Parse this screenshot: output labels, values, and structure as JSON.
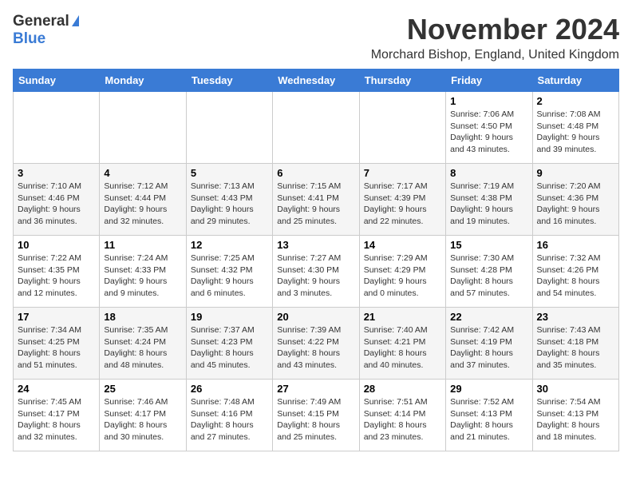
{
  "logo": {
    "general": "General",
    "blue": "Blue"
  },
  "title": "November 2024",
  "location": "Morchard Bishop, England, United Kingdom",
  "days_of_week": [
    "Sunday",
    "Monday",
    "Tuesday",
    "Wednesday",
    "Thursday",
    "Friday",
    "Saturday"
  ],
  "weeks": [
    [
      {
        "day": "",
        "info": ""
      },
      {
        "day": "",
        "info": ""
      },
      {
        "day": "",
        "info": ""
      },
      {
        "day": "",
        "info": ""
      },
      {
        "day": "",
        "info": ""
      },
      {
        "day": "1",
        "info": "Sunrise: 7:06 AM\nSunset: 4:50 PM\nDaylight: 9 hours and 43 minutes."
      },
      {
        "day": "2",
        "info": "Sunrise: 7:08 AM\nSunset: 4:48 PM\nDaylight: 9 hours and 39 minutes."
      }
    ],
    [
      {
        "day": "3",
        "info": "Sunrise: 7:10 AM\nSunset: 4:46 PM\nDaylight: 9 hours and 36 minutes."
      },
      {
        "day": "4",
        "info": "Sunrise: 7:12 AM\nSunset: 4:44 PM\nDaylight: 9 hours and 32 minutes."
      },
      {
        "day": "5",
        "info": "Sunrise: 7:13 AM\nSunset: 4:43 PM\nDaylight: 9 hours and 29 minutes."
      },
      {
        "day": "6",
        "info": "Sunrise: 7:15 AM\nSunset: 4:41 PM\nDaylight: 9 hours and 25 minutes."
      },
      {
        "day": "7",
        "info": "Sunrise: 7:17 AM\nSunset: 4:39 PM\nDaylight: 9 hours and 22 minutes."
      },
      {
        "day": "8",
        "info": "Sunrise: 7:19 AM\nSunset: 4:38 PM\nDaylight: 9 hours and 19 minutes."
      },
      {
        "day": "9",
        "info": "Sunrise: 7:20 AM\nSunset: 4:36 PM\nDaylight: 9 hours and 16 minutes."
      }
    ],
    [
      {
        "day": "10",
        "info": "Sunrise: 7:22 AM\nSunset: 4:35 PM\nDaylight: 9 hours and 12 minutes."
      },
      {
        "day": "11",
        "info": "Sunrise: 7:24 AM\nSunset: 4:33 PM\nDaylight: 9 hours and 9 minutes."
      },
      {
        "day": "12",
        "info": "Sunrise: 7:25 AM\nSunset: 4:32 PM\nDaylight: 9 hours and 6 minutes."
      },
      {
        "day": "13",
        "info": "Sunrise: 7:27 AM\nSunset: 4:30 PM\nDaylight: 9 hours and 3 minutes."
      },
      {
        "day": "14",
        "info": "Sunrise: 7:29 AM\nSunset: 4:29 PM\nDaylight: 9 hours and 0 minutes."
      },
      {
        "day": "15",
        "info": "Sunrise: 7:30 AM\nSunset: 4:28 PM\nDaylight: 8 hours and 57 minutes."
      },
      {
        "day": "16",
        "info": "Sunrise: 7:32 AM\nSunset: 4:26 PM\nDaylight: 8 hours and 54 minutes."
      }
    ],
    [
      {
        "day": "17",
        "info": "Sunrise: 7:34 AM\nSunset: 4:25 PM\nDaylight: 8 hours and 51 minutes."
      },
      {
        "day": "18",
        "info": "Sunrise: 7:35 AM\nSunset: 4:24 PM\nDaylight: 8 hours and 48 minutes."
      },
      {
        "day": "19",
        "info": "Sunrise: 7:37 AM\nSunset: 4:23 PM\nDaylight: 8 hours and 45 minutes."
      },
      {
        "day": "20",
        "info": "Sunrise: 7:39 AM\nSunset: 4:22 PM\nDaylight: 8 hours and 43 minutes."
      },
      {
        "day": "21",
        "info": "Sunrise: 7:40 AM\nSunset: 4:21 PM\nDaylight: 8 hours and 40 minutes."
      },
      {
        "day": "22",
        "info": "Sunrise: 7:42 AM\nSunset: 4:19 PM\nDaylight: 8 hours and 37 minutes."
      },
      {
        "day": "23",
        "info": "Sunrise: 7:43 AM\nSunset: 4:18 PM\nDaylight: 8 hours and 35 minutes."
      }
    ],
    [
      {
        "day": "24",
        "info": "Sunrise: 7:45 AM\nSunset: 4:17 PM\nDaylight: 8 hours and 32 minutes."
      },
      {
        "day": "25",
        "info": "Sunrise: 7:46 AM\nSunset: 4:17 PM\nDaylight: 8 hours and 30 minutes."
      },
      {
        "day": "26",
        "info": "Sunrise: 7:48 AM\nSunset: 4:16 PM\nDaylight: 8 hours and 27 minutes."
      },
      {
        "day": "27",
        "info": "Sunrise: 7:49 AM\nSunset: 4:15 PM\nDaylight: 8 hours and 25 minutes."
      },
      {
        "day": "28",
        "info": "Sunrise: 7:51 AM\nSunset: 4:14 PM\nDaylight: 8 hours and 23 minutes."
      },
      {
        "day": "29",
        "info": "Sunrise: 7:52 AM\nSunset: 4:13 PM\nDaylight: 8 hours and 21 minutes."
      },
      {
        "day": "30",
        "info": "Sunrise: 7:54 AM\nSunset: 4:13 PM\nDaylight: 8 hours and 18 minutes."
      }
    ]
  ]
}
